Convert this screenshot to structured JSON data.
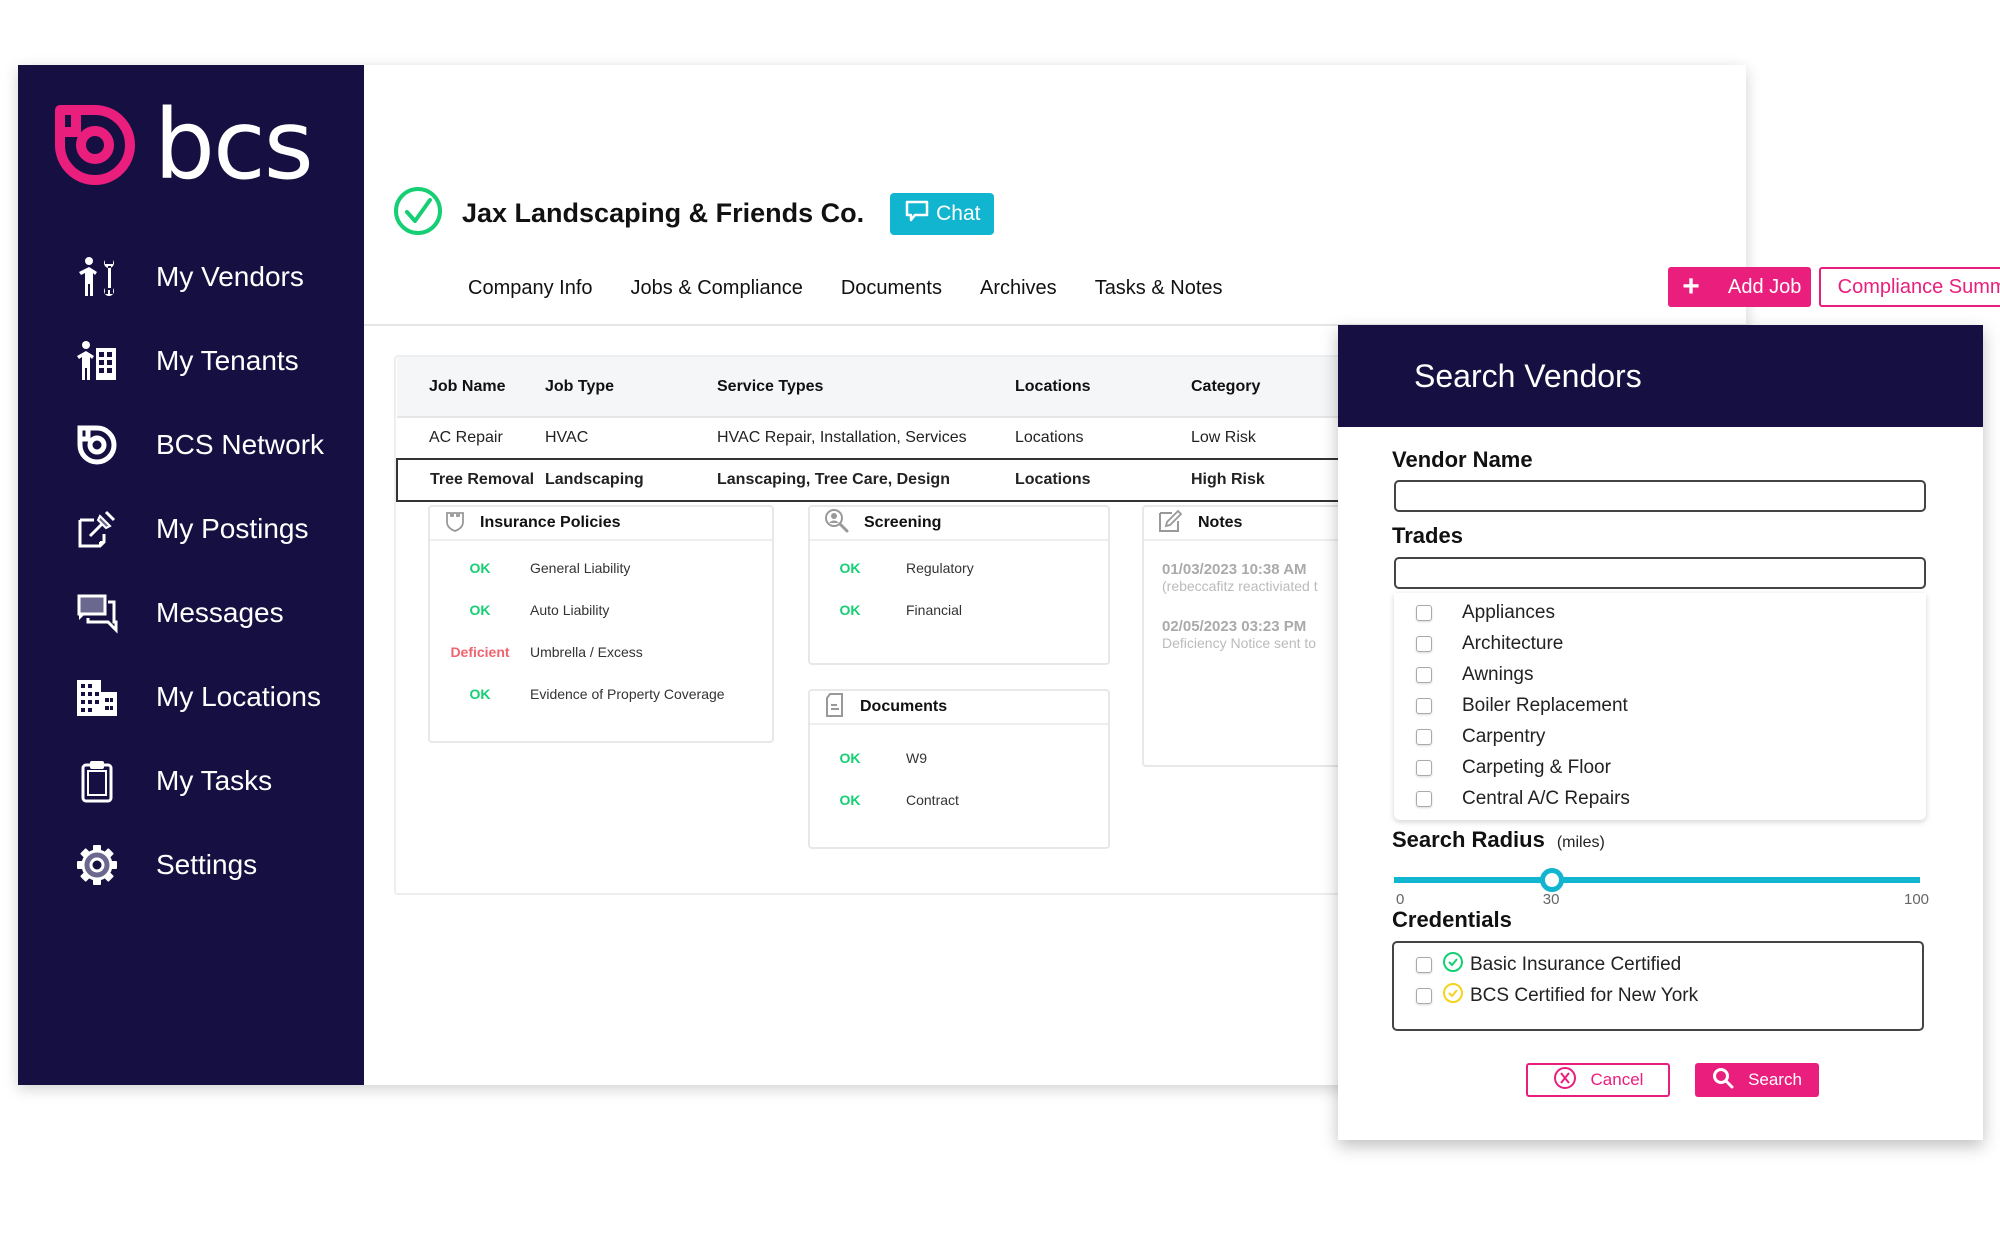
{
  "brand": {
    "name": "bcs",
    "primary_color": "#161042",
    "accent_color": "#e91e7d",
    "teal_color": "#12b5d0",
    "ok_color": "#16cf74",
    "deficient_color": "#f0636f"
  },
  "sidebar": {
    "items": [
      {
        "label": "My Vendors",
        "icon": "vendor-worker-icon"
      },
      {
        "label": "My Tenants",
        "icon": "tenant-building-icon"
      },
      {
        "label": "BCS Network",
        "icon": "bcs-network-icon"
      },
      {
        "label": "My Postings",
        "icon": "pin-posting-icon"
      },
      {
        "label": "Messages",
        "icon": "messages-icon"
      },
      {
        "label": "My Locations",
        "icon": "locations-building-icon"
      },
      {
        "label": "My Tasks",
        "icon": "clipboard-icon"
      },
      {
        "label": "Settings",
        "icon": "gear-icon"
      }
    ]
  },
  "vendor": {
    "name": "Jax Landscaping & Friends Co.",
    "status": "verified",
    "chat_label": "Chat"
  },
  "tabs": [
    "Company Info",
    "Jobs & Compliance",
    "Documents",
    "Archives",
    "Tasks & Notes"
  ],
  "actions": {
    "add_job": "Add Job",
    "compliance_summary": "Compliance Summary"
  },
  "jobs_table": {
    "headers": [
      "Job Name",
      "Job Type",
      "Service Types",
      "Locations",
      "Category"
    ],
    "rows": [
      [
        "AC Repair",
        "HVAC",
        "HVAC Repair, Installation, Services",
        "Locations",
        "Low Risk"
      ],
      [
        "Tree Removal",
        "Landscaping",
        "Lanscaping, Tree Care, Design",
        "Locations",
        "High Risk"
      ]
    ],
    "selected_row": 1
  },
  "insurance": {
    "title": "Insurance Policies",
    "items": [
      {
        "status": "OK",
        "label": "General Liability"
      },
      {
        "status": "OK",
        "label": "Auto Liability"
      },
      {
        "status": "Deficient",
        "label": "Umbrella / Excess"
      },
      {
        "status": "OK",
        "label": "Evidence of Property Coverage"
      }
    ]
  },
  "screening": {
    "title": "Screening",
    "items": [
      {
        "status": "OK",
        "label": "Regulatory"
      },
      {
        "status": "OK",
        "label": "Financial"
      }
    ]
  },
  "documents": {
    "title": "Documents",
    "items": [
      {
        "status": "OK",
        "label": "W9"
      },
      {
        "status": "OK",
        "label": "Contract"
      }
    ]
  },
  "notes": {
    "title": "Notes",
    "items": [
      {
        "time": "01/03/2023 10:38 AM",
        "text": "(rebeccafitz reactiviated t"
      },
      {
        "time": "02/05/2023 03:23 PM",
        "text": "Deficiency Notice sent to"
      }
    ]
  },
  "search_modal": {
    "title": "Search Vendors",
    "vendor_name_label": "Vendor Name",
    "vendor_name_value": "",
    "trades_label": "Trades",
    "trades_value": "",
    "trades": [
      "Appliances",
      "Architecture",
      "Awnings",
      "Boiler Replacement",
      "Carpentry",
      "Carpeting & Floor",
      "Central A/C Repairs"
    ],
    "radius_label": "Search Radius",
    "radius_unit": "(miles)",
    "radius_min": "0",
    "radius_max": "100",
    "radius_value": "30",
    "credentials_label": "Credentials",
    "credentials": [
      {
        "label": "Basic Insurance Certified",
        "icon_color": "#16cf74"
      },
      {
        "label": "BCS Certified for New York",
        "icon_color": "#f5d31c"
      }
    ],
    "cancel_label": "Cancel",
    "search_label": "Search"
  }
}
